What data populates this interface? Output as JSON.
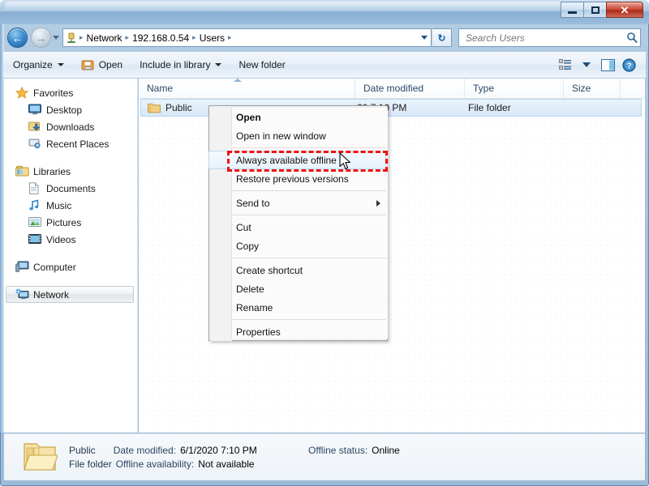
{
  "window": {
    "minimize_label": "Minimize",
    "maximize_label": "Maximize",
    "close_label": "Close"
  },
  "addressbar": {
    "back_label": "Back",
    "forward_label": "Forward",
    "recent_label": "Recent pages",
    "icon": "network-folder-icon",
    "crumbs": [
      "Network",
      "192.168.0.54",
      "Users"
    ],
    "separator": "▸",
    "dropdown_label": "Previous locations",
    "refresh_label": "Refresh",
    "refresh_glyph": "↻"
  },
  "search": {
    "placeholder": "Search Users",
    "value": "",
    "icon": "search-icon"
  },
  "toolbar": {
    "organize": "Organize",
    "open": "Open",
    "include_in_library": "Include in library",
    "new_folder": "New folder",
    "view_icon": "view-layout-icon",
    "view_caret": "change-view-caret",
    "preview_icon": "preview-pane-icon",
    "help_icon": "help-icon",
    "help_glyph": "?"
  },
  "sidebar": {
    "groups": [
      {
        "header": {
          "label": "Favorites",
          "icon": "star-icon"
        },
        "items": [
          {
            "label": "Desktop",
            "icon": "desktop-icon"
          },
          {
            "label": "Downloads",
            "icon": "downloads-icon"
          },
          {
            "label": "Recent Places",
            "icon": "recent-places-icon"
          }
        ]
      },
      {
        "header": {
          "label": "Libraries",
          "icon": "libraries-icon"
        },
        "items": [
          {
            "label": "Documents",
            "icon": "document-icon"
          },
          {
            "label": "Music",
            "icon": "music-note-icon"
          },
          {
            "label": "Pictures",
            "icon": "picture-icon"
          },
          {
            "label": "Videos",
            "icon": "video-icon"
          }
        ]
      },
      {
        "header": {
          "label": "Computer",
          "icon": "computer-icon"
        },
        "items": []
      },
      {
        "header": {
          "label": "Network",
          "icon": "network-icon",
          "selected": true
        },
        "items": []
      }
    ]
  },
  "filelist": {
    "columns": [
      {
        "key": "name",
        "label": "Name",
        "sorted": "asc"
      },
      {
        "key": "date",
        "label": "Date modified"
      },
      {
        "key": "type",
        "label": "Type"
      },
      {
        "key": "size",
        "label": "Size"
      }
    ],
    "rows": [
      {
        "name": "Public",
        "icon": "folder-icon",
        "date": "20 7:10 PM",
        "type": "File folder",
        "size": "",
        "selected": true
      }
    ]
  },
  "context_menu": {
    "items": [
      {
        "label": "Open",
        "bold": true,
        "type": "item"
      },
      {
        "label": "Open in new window",
        "type": "item"
      },
      {
        "type": "separator"
      },
      {
        "label": "Always available offline",
        "type": "item",
        "highlighted": true
      },
      {
        "label": "Restore previous versions",
        "type": "item"
      },
      {
        "type": "separator"
      },
      {
        "label": "Send to",
        "type": "submenu"
      },
      {
        "type": "separator"
      },
      {
        "label": "Cut",
        "type": "item"
      },
      {
        "label": "Copy",
        "type": "item"
      },
      {
        "type": "separator"
      },
      {
        "label": "Create shortcut",
        "type": "item"
      },
      {
        "label": "Delete",
        "type": "item"
      },
      {
        "label": "Rename",
        "type": "item"
      },
      {
        "type": "separator"
      },
      {
        "label": "Properties",
        "type": "item"
      }
    ]
  },
  "annotation": {
    "highlight_color": "#ee1111",
    "target_label": "Always available offline",
    "cursor": "arrow-cursor"
  },
  "statusbar": {
    "icon": "folder-icon-large",
    "name": "Public",
    "kind": "File folder",
    "date_modified_key": "Date modified:",
    "date_modified_value": "6/1/2020 7:10 PM",
    "offline_availability_key": "Offline availability:",
    "offline_availability_value": "Not available",
    "offline_status_key": "Offline status:",
    "offline_status_value": "Online"
  }
}
